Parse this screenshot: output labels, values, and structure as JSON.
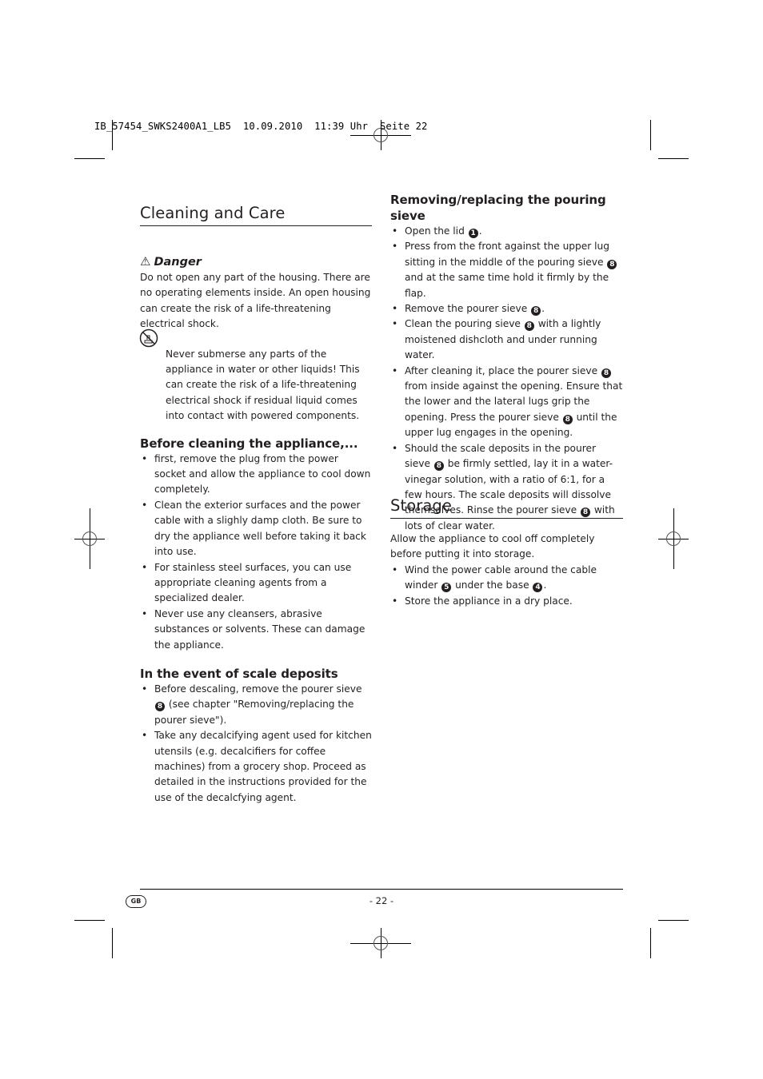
{
  "slug": "IB_57454_SWKS2400A1_LB5  10.09.2010  11:39 Uhr  Seite 22",
  "left": {
    "title": "Cleaning and Care",
    "danger": {
      "icon": "warning-triangle-icon",
      "label": "Danger",
      "text": "Do not open any part of the housing. There are no operating elements inside. An open housing can create the risk of a life-threatening electrical shock."
    },
    "warning": {
      "icon": "no-submerse-icon",
      "text": "Never submerse any parts of the appliance in water or other liquids! This can create the risk of a life-threatening electrical shock if residual liquid comes into contact with powered components."
    },
    "before": {
      "heading": "Before cleaning the appliance,...",
      "items": [
        "first, remove the plug from the power socket and allow the appliance to cool down completely.",
        "Clean the exterior surfaces and the power cable with a slighly damp cloth. Be sure to dry the appliance well before taking it back into use.",
        "For stainless steel surfaces, you can use appropriate cleaning agents from a specialized dealer.",
        "Never use any cleansers, abrasive substances or solvents. These can damage the appliance."
      ]
    },
    "scale": {
      "heading": "In the event of scale deposits",
      "item1_a": "Before descaling, remove the pourer sieve",
      "item1_num": "8",
      "item1_b": "(see chapter \"Removing/replacing the pourer sieve\").",
      "item2": "Take any decalcifying agent used for kitchen utensils (e.g. decalcifiers for coffee machines) from a grocery shop. Proceed as detailed in the instructions provided for the use of the decalcfying agent."
    }
  },
  "right": {
    "sieve": {
      "heading": "Removing/replacing the pouring sieve",
      "i1_a": "Open the lid",
      "i1_num": "1",
      "i1_b": ".",
      "i2_a": "Press from the front against the upper lug sitting in the middle of the pouring sieve",
      "i2_num": "8",
      "i2_b": "and at the same time hold it firmly by the flap.",
      "i3_a": "Remove the pourer sieve",
      "i3_num": "8",
      "i3_b": ".",
      "i4_a": "Clean the pouring sieve",
      "i4_num": "8",
      "i4_b": "with a lightly moistened dishcloth and under running water.",
      "i5_a": "After cleaning it, place the pourer sieve",
      "i5_num": "8",
      "i5_b": "from inside against the opening. Ensure that the lower and the lateral lugs grip the opening. Press the pourer sieve",
      "i5_num2": "8",
      "i5_c": "until the upper lug engages in the opening.",
      "i6_a": "Should the scale deposits in the pourer sieve",
      "i6_num": "8",
      "i6_b": "be firmly settled, lay it in a water-vinegar solution, with a ratio of 6:1, for a few hours. The scale deposits will dissolve themselves. Rinse the pourer sieve",
      "i6_num2": "8",
      "i6_c": "with lots of clear water."
    },
    "storage": {
      "title": "Storage",
      "intro": "Allow the appliance to cool off completely before putting it into storage.",
      "s1_a": "Wind the power cable around the cable winder",
      "s1_num": "5",
      "s1_b": "under the base",
      "s1_num2": "4",
      "s1_c": ".",
      "s2": "Store the appliance in a dry place."
    }
  },
  "footer": {
    "country": "GB",
    "page": "- 22 -"
  },
  "bullet": "•"
}
